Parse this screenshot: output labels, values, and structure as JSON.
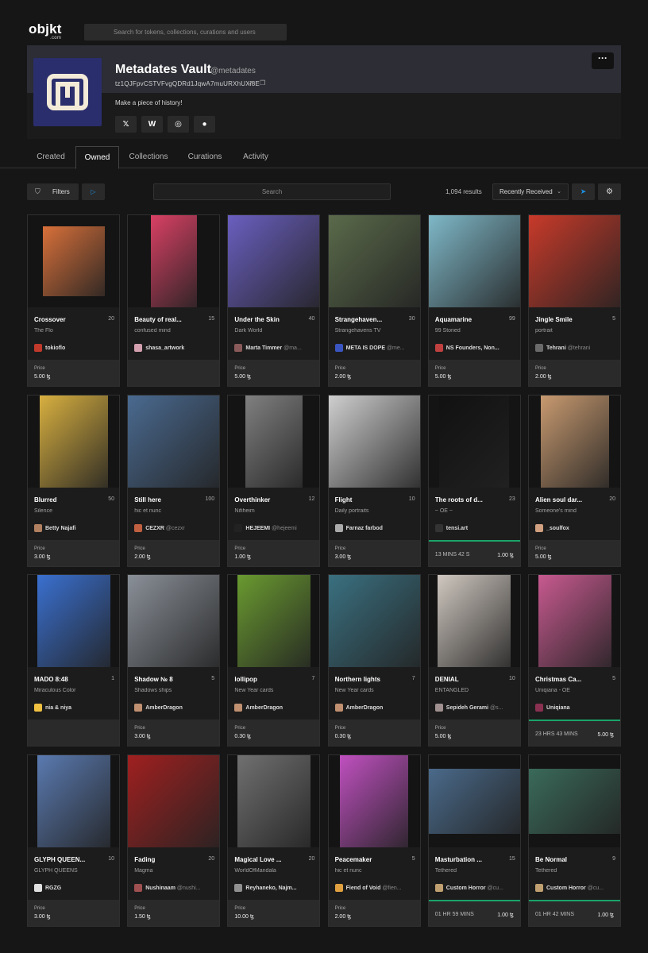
{
  "header": {
    "logo": "objkt",
    "logo_sub": ".com",
    "search_placeholder": "Search for tokens, collections, curations and users"
  },
  "profile": {
    "name": "Metadates Vault",
    "handle": "@metadates",
    "address": "tz1QJFpvCSTVFvgQDRd1JqwA7muURXhUXi8E",
    "description": "Make a piece of history!",
    "more_label": "···",
    "socials": [
      {
        "name": "x",
        "glyph": "𝕏"
      },
      {
        "name": "w",
        "glyph": "W"
      },
      {
        "name": "discord",
        "glyph": "◎"
      },
      {
        "name": "website",
        "glyph": "●"
      }
    ]
  },
  "tabs": [
    {
      "label": "Created"
    },
    {
      "label": "Owned",
      "active": true
    },
    {
      "label": "Collections"
    },
    {
      "label": "Curations"
    },
    {
      "label": "Activity"
    }
  ],
  "toolbar": {
    "filters_label": "Filters",
    "search_placeholder": "Search",
    "results": "1,094 results",
    "sort": "Recently Received"
  },
  "cards": [
    {
      "title": "Crossover",
      "edition": "20",
      "collection": "The Flo",
      "creator": "tokioflo",
      "handle": "",
      "price_label": "Price",
      "price": "5.00 ꜩ",
      "avatar": "#c0392b",
      "art": "#d8703a"
    },
    {
      "title": "Beauty of real...",
      "edition": "15",
      "collection": "confused mind",
      "creator": "shasa_artwork",
      "handle": "",
      "price_label": "",
      "price": "",
      "avatar": "#d4a0b0",
      "art": "#d94064"
    },
    {
      "title": "Under the Skin",
      "edition": "40",
      "collection": "Dark World",
      "creator": "Marta Timmer",
      "handle": "@ma...",
      "price_label": "Price",
      "price": "5.00 ꜩ",
      "avatar": "#8a5a5a",
      "art": "#6a5fc0"
    },
    {
      "title": "Strangehaven...",
      "edition": "30",
      "collection": "Strangehavens TV",
      "creator": "META IS DOPE",
      "handle": "@me...",
      "price_label": "Price",
      "price": "2.00 ꜩ",
      "avatar": "#3a55c0",
      "art": "#5a6a4a"
    },
    {
      "title": "Aquamarine",
      "edition": "99",
      "collection": "99 Stoned",
      "creator": "NS Founders, Non...",
      "handle": "",
      "price_label": "Price",
      "price": "5.00 ꜩ",
      "avatar": "#c04040",
      "art": "#7fb8c8"
    },
    {
      "title": "Jingle Smile",
      "edition": "5",
      "collection": "portrait",
      "creator": "Tehrani",
      "handle": "@tehrani",
      "price_label": "Price",
      "price": "2.00 ꜩ",
      "avatar": "#6a6a6a",
      "art": "#c83a2a"
    },
    {
      "title": "Blurred",
      "edition": "50",
      "collection": "Silence",
      "creator": "Betty Najafi",
      "handle": "",
      "price_label": "Price",
      "price": "3.00 ꜩ",
      "avatar": "#b08060",
      "art": "#d8b040"
    },
    {
      "title": "Still here",
      "edition": "100",
      "collection": "hic et nunc",
      "creator": "CEZXR",
      "handle": "@cezxr",
      "price_label": "Price",
      "price": "2.00 ꜩ",
      "avatar": "#c06040",
      "art": "#4a6a90"
    },
    {
      "title": "Overthinker",
      "edition": "12",
      "collection": "Nifiheim",
      "creator": "HEJEEMI",
      "handle": "@hejeemi",
      "price_label": "Price",
      "price": "1.00 ꜩ",
      "avatar": "#222222",
      "art": "#808080"
    },
    {
      "title": "Flight",
      "edition": "10",
      "collection": "Daily portraits",
      "creator": "Farnaz farbod",
      "handle": "",
      "price_label": "Price",
      "price": "3.00 ꜩ",
      "avatar": "#aaaaaa",
      "art": "#cfcfcf"
    },
    {
      "title": "The roots of d...",
      "edition": "23",
      "collection": "~ OE ~",
      "creator": "tensi.art",
      "handle": "",
      "price_label": "",
      "price": "1.00 ꜩ",
      "timer": "13 MINS  42 S",
      "avatar": "#333333",
      "art": "#111111"
    },
    {
      "title": "Alien soul dar...",
      "edition": "20",
      "collection": "Someone's mind",
      "creator": "_soulfox",
      "handle": "",
      "price_label": "Price",
      "price": "5.00 ꜩ",
      "avatar": "#d0a080",
      "art": "#c89a70"
    },
    {
      "title": "MADO 8:48",
      "edition": "1",
      "collection": "Miraculous Color",
      "creator": "nia & niya",
      "handle": "",
      "price_label": "",
      "price": "",
      "avatar": "#f0c040",
      "art": "#3a70d0"
    },
    {
      "title": "Shadow № 8",
      "edition": "5",
      "collection": "Shadows ships",
      "creator": "AmberDragon",
      "handle": "",
      "price_label": "Price",
      "price": "3.00 ꜩ",
      "avatar": "#c09070",
      "art": "#8a9098"
    },
    {
      "title": "lollipop",
      "edition": "7",
      "collection": "New Year cards",
      "creator": "AmberDragon",
      "handle": "",
      "price_label": "Price",
      "price": "0.30 ꜩ",
      "avatar": "#c09070",
      "art": "#6a9a30"
    },
    {
      "title": "Northern lights",
      "edition": "7",
      "collection": "New Year cards",
      "creator": "AmberDragon",
      "handle": "",
      "price_label": "Price",
      "price": "0.30 ꜩ",
      "avatar": "#c09070",
      "art": "#3a7080"
    },
    {
      "title": "DENIAL",
      "edition": "10",
      "collection": "ENTANGLED",
      "creator": "Sepideh Gerami",
      "handle": "@s...",
      "price_label": "Price",
      "price": "5.00 ꜩ",
      "avatar": "#a09090",
      "art": "#d0c8c0"
    },
    {
      "title": "Christmas Ca...",
      "edition": "5",
      "collection": "Uniqiana - OE",
      "creator": "Uniqiana",
      "handle": "",
      "price_label": "",
      "price": "5.00 ꜩ",
      "timer": "23 HRS  43 MINS",
      "avatar": "#8a3050",
      "art": "#c85a90"
    },
    {
      "title": "GLYPH QUEEN...",
      "edition": "10",
      "collection": "GLYPH QUEENS",
      "creator": "RGZG",
      "handle": "",
      "price_label": "Price",
      "price": "3.00 ꜩ",
      "avatar": "#e0e0e0",
      "art": "#5a7ab0"
    },
    {
      "title": "Fading",
      "edition": "20",
      "collection": "Magma",
      "creator": "Nushinaam",
      "handle": "@nushi...",
      "price_label": "Price",
      "price": "1.50 ꜩ",
      "avatar": "#a05050",
      "art": "#a02020"
    },
    {
      "title": "Magical Love ...",
      "edition": "20",
      "collection": "WorldOfMandala",
      "creator": "Reyhaneko, Najm...",
      "handle": "",
      "price_label": "Price",
      "price": "10.00 ꜩ",
      "avatar": "#909090",
      "art": "#707070"
    },
    {
      "title": "Peacemaker",
      "edition": "5",
      "collection": "hic et nunc",
      "creator": "Fiend of Void",
      "handle": "@fien...",
      "price_label": "Price",
      "price": "2.00 ꜩ",
      "avatar": "#e0a040",
      "art": "#c050c0"
    },
    {
      "title": "Masturbation ...",
      "edition": "15",
      "collection": "Tethered",
      "creator": "Custom Horror",
      "handle": "@cu...",
      "price_label": "",
      "price": "1.00 ꜩ",
      "timer": "01 HR  59 MINS",
      "avatar": "#c0a070",
      "art": "#4a6a8a"
    },
    {
      "title": "Be Normal",
      "edition": "9",
      "collection": "Tethered",
      "creator": "Custom Horror",
      "handle": "@cu...",
      "price_label": "",
      "price": "1.00 ꜩ",
      "timer": "01 HR  42 MINS",
      "avatar": "#c0a070",
      "art": "#3a6a5a"
    }
  ]
}
